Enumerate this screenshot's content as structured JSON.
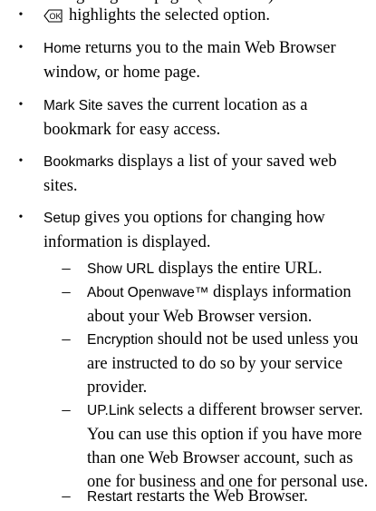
{
  "cutoff_text": "Navigating web pages (continued)",
  "items": [
    {
      "term": "",
      "text": "highlights the selected option.",
      "icon": "ok-key-icon"
    },
    {
      "term": "Home",
      "text": " returns you to the main Web Browser window, or home page."
    },
    {
      "term": "Mark Site",
      "text": " saves the current location as a bookmark for easy access."
    },
    {
      "term": "Bookmarks",
      "text": " displays a list of your saved web sites."
    },
    {
      "term": "Setup",
      "text": " gives you options for changing how information is displayed."
    }
  ],
  "bullet_symbol": "•",
  "sub_dash": "–",
  "setup_options": [
    {
      "term": "Show URL",
      "text": " displays the entire URL."
    },
    {
      "term": "About Openwave™",
      "text": " displays information about your Web Browser version."
    },
    {
      "term": "Encryption",
      "text": " should not be used unless you are instructed to do so by your service provider."
    },
    {
      "term": "UP.Link",
      "text": " selects a different browser server. You can use this option if you have more than one Web Browser account, such as one for business and one for personal use."
    },
    {
      "term": "Restart",
      "text": " restarts the Web Browser."
    }
  ]
}
